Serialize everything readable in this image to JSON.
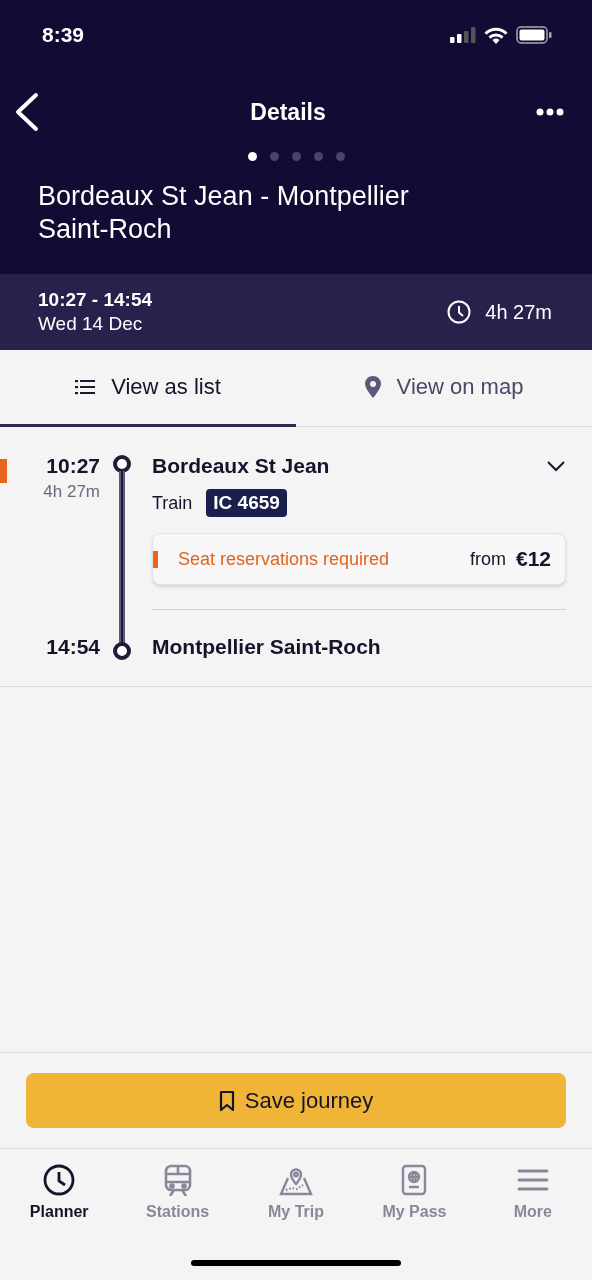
{
  "status_bar": {
    "time": "8:39"
  },
  "nav": {
    "title": "Details"
  },
  "pager": [
    {
      "selected": true
    },
    {
      "selected": false
    },
    {
      "selected": false
    },
    {
      "selected": false
    },
    {
      "selected": false
    }
  ],
  "route_title": "Bordeaux St Jean - Montpellier Saint-Roch",
  "summary": {
    "times": "10:27 - 14:54",
    "date": "Wed 14 Dec",
    "duration": "4h 27m"
  },
  "view_tabs": [
    {
      "label": "View as list",
      "selected": true
    },
    {
      "label": "View on map",
      "selected": false
    }
  ],
  "leg": {
    "departure_time": "10:27",
    "duration": "4h 27m",
    "departure_station": "Bordeaux St Jean",
    "mode": "Train",
    "train_number": "IC 4659",
    "notice": {
      "text": "Seat reservations required",
      "price_prefix": "from",
      "price": "€12"
    },
    "arrival_time": "14:54",
    "arrival_station": "Montpellier Saint-Roch"
  },
  "save_button": {
    "label": "Save journey"
  },
  "tab_bar": [
    {
      "label": "Planner",
      "selected": true
    },
    {
      "label": "Stations",
      "selected": false
    },
    {
      "label": "My Trip",
      "selected": false
    },
    {
      "label": "My Pass",
      "selected": false
    },
    {
      "label": "More",
      "selected": false
    }
  ]
}
